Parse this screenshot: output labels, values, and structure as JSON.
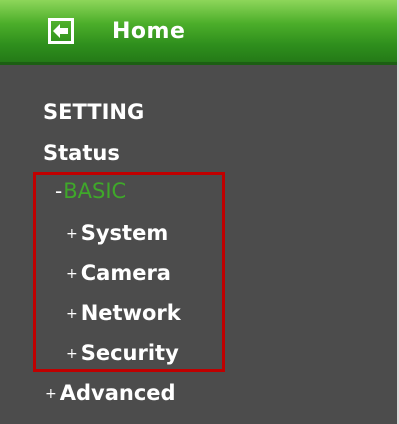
{
  "header": {
    "home_label": "Home",
    "back_icon": "back-arrow-icon"
  },
  "menu": {
    "setting_label": "SETTING",
    "status_label": "Status",
    "basic": {
      "prefix": "-",
      "label": "BASIC",
      "label_color": "#3fa82a"
    },
    "basic_items": [
      {
        "prefix": "+",
        "label": "System"
      },
      {
        "prefix": "+",
        "label": "Camera"
      },
      {
        "prefix": "+",
        "label": "Network"
      },
      {
        "prefix": "+",
        "label": "Security"
      }
    ],
    "advanced": {
      "prefix": "+",
      "label": "Advanced"
    }
  },
  "colors": {
    "panel_background": "#4c4c4c",
    "header_green": "#2f8f1d",
    "highlight_border": "#c00000",
    "text": "#ffffff"
  }
}
